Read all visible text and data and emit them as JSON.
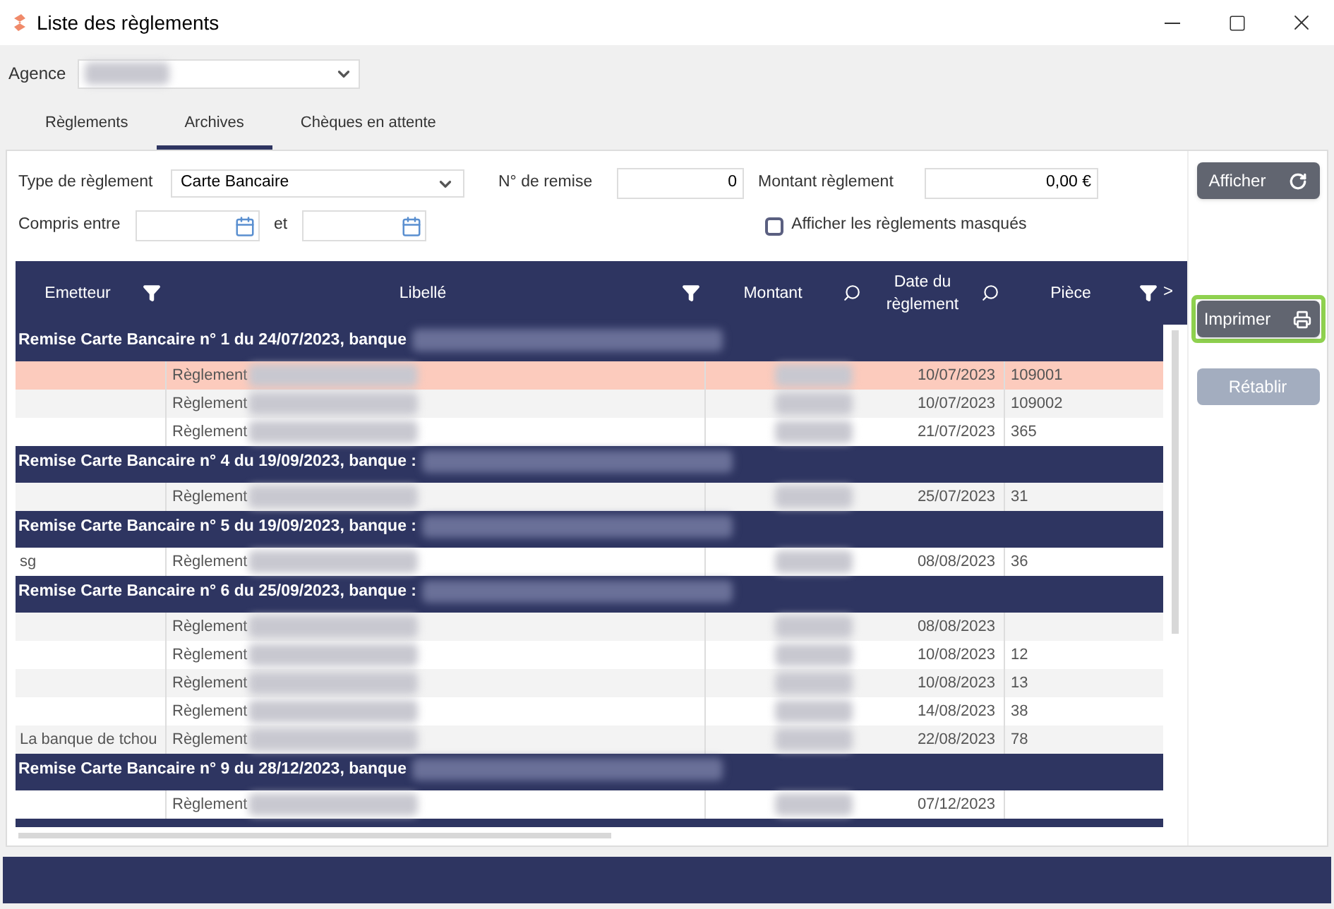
{
  "window": {
    "title": "Liste des règlements"
  },
  "agence": {
    "label": "Agence"
  },
  "tabs": [
    {
      "label": "Règlements",
      "selected": false
    },
    {
      "label": "Archives",
      "selected": true
    },
    {
      "label": "Chèques en attente",
      "selected": false
    }
  ],
  "filters": {
    "type_label": "Type de règlement",
    "type_value": "Carte Bancaire",
    "remise_label": "N° de remise",
    "remise_value": "0",
    "montant_label": "Montant règlement",
    "montant_value": "0,00 €",
    "compris_label": "Compris entre",
    "et_label": "et",
    "masques_label": "Afficher les règlements masqués",
    "masques_checked": false
  },
  "buttons": [
    {
      "label": "Afficher",
      "kind": "refresh",
      "disabled": false,
      "focused": false
    },
    {
      "label": "Imprimer",
      "kind": "print",
      "disabled": false,
      "focused": true
    },
    {
      "label": "Rétablir",
      "kind": "plain",
      "disabled": true,
      "focused": false
    }
  ],
  "table": {
    "columns": [
      {
        "label": "Emetteur",
        "kind": "filter"
      },
      {
        "label": "Libellé",
        "kind": "filter"
      },
      {
        "label": "Montant",
        "kind": "search"
      },
      {
        "label": "Date du règlement",
        "kind": "search"
      },
      {
        "label": "Pièce",
        "kind": "filter"
      }
    ],
    "scroll_right": ">",
    "groups": [
      {
        "title": "Remise Carte Bancaire n° 1 du 24/07/2023, banque",
        "rows": [
          {
            "libelle": "Règlement",
            "date": "10/07/2023",
            "piece": "109001",
            "selected": true
          },
          {
            "libelle": "Règlement",
            "date": "10/07/2023",
            "piece": "109002",
            "selected": false
          },
          {
            "libelle": "Règlement",
            "date": "21/07/2023",
            "piece": "365",
            "selected": false
          }
        ]
      },
      {
        "title": "Remise Carte Bancaire n° 4 du 19/09/2023, banque :",
        "rows": [
          {
            "libelle": "Règlement",
            "date": "25/07/2023",
            "piece": "31",
            "selected": false
          }
        ]
      },
      {
        "title": "Remise Carte Bancaire n° 5 du 19/09/2023, banque :",
        "rows": [
          {
            "emetteur": "sg",
            "libelle": "Règlement",
            "date": "08/08/2023",
            "piece": "36",
            "selected": false
          }
        ]
      },
      {
        "title": "Remise Carte Bancaire n° 6 du 25/09/2023, banque :",
        "rows": [
          {
            "libelle": "Règlement",
            "date": "08/08/2023",
            "selected": false
          },
          {
            "libelle": "Règlement",
            "date": "10/08/2023",
            "piece": "12",
            "selected": false
          },
          {
            "libelle": "Règlement",
            "date": "10/08/2023",
            "piece": "13",
            "selected": false
          },
          {
            "libelle": "Règlement",
            "date": "14/08/2023",
            "piece": "38",
            "selected": false
          },
          {
            "emetteur": "La banque de tchou",
            "libelle": "Règlement",
            "date": "22/08/2023",
            "piece": "78",
            "selected": false
          }
        ]
      },
      {
        "title": "Remise Carte Bancaire n° 9 du 28/12/2023, banque",
        "rows": [
          {
            "libelle": "Règlement",
            "date": "07/12/2023",
            "selected": false
          }
        ]
      }
    ]
  }
}
